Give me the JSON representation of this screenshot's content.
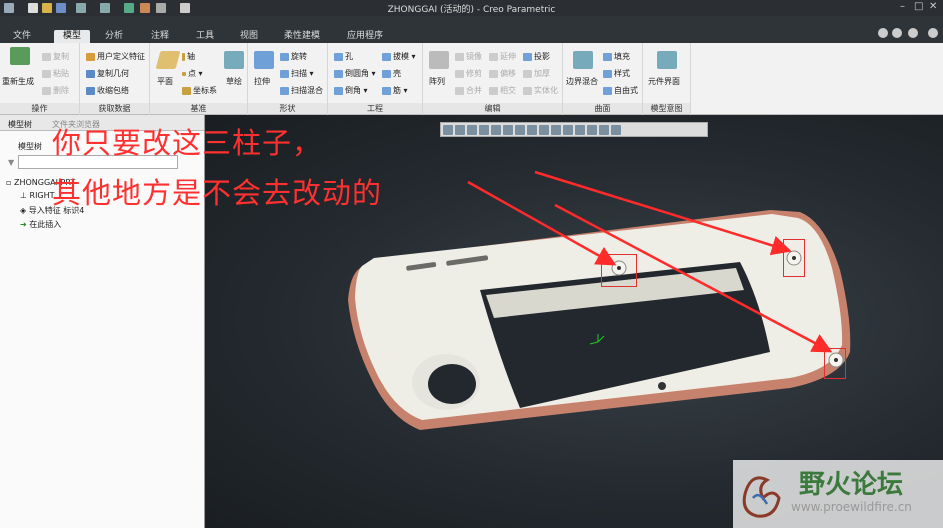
{
  "window": {
    "title": "ZHONGGAI (活动的) - Creo Parametric"
  },
  "menu_tabs": [
    "文件",
    "模型",
    "分析",
    "注释",
    "工具",
    "视图",
    "柔性建模",
    "应用程序"
  ],
  "active_tab": "模型",
  "ribbon": {
    "ops": {
      "regen": "重新生成",
      "copy": "复制",
      "paste": "粘贴",
      "delete": "删除",
      "label": "操作"
    },
    "get": {
      "udf": "用户定义特征",
      "copygeom": "复制几何",
      "shrink": "收缩包络",
      "label": "获取数据"
    },
    "datum": {
      "plane": "平面",
      "axis": "轴",
      "point": "点",
      "csys": "坐标系",
      "sketch": "草绘",
      "label": "基准"
    },
    "shapes": {
      "extrude": "拉伸",
      "revolve": "旋转",
      "sweep": "扫描",
      "blend": "扫描混合",
      "label": "形状"
    },
    "eng": {
      "hole": "孔",
      "draft": "拔模",
      "round": "倒圆角",
      "shell": "壳",
      "chamfer": "倒角",
      "rib": "筋",
      "label": "工程"
    },
    "edit": {
      "pattern": "阵列",
      "mirror": "镜像",
      "extend": "延伸",
      "project": "投影",
      "trim": "修剪",
      "offset": "偏移",
      "thicken": "加厚",
      "merge": "合并",
      "intersect": "相交",
      "solidify": "实体化",
      "label": "编辑"
    },
    "surf": {
      "boundary": "边界混合",
      "fill": "填充",
      "style": "样式",
      "freestyle": "自由式",
      "label": "曲面"
    },
    "intent": {
      "ui": "元件界面",
      "label": "模型意图"
    }
  },
  "model_tree": {
    "tabs": [
      "模型树",
      "文件夹浏览器"
    ],
    "header": "模型树",
    "items": [
      "ZHONGGAI.PRT",
      "RIGHT",
      "导入特征 标识4",
      "在此插入"
    ]
  },
  "annotation": {
    "line1": "你只要改这三柱子，",
    "line2": "其他地方是不会去改动的"
  },
  "watermark": {
    "brand": "野火论坛",
    "url": "www.proewildfire.cn"
  }
}
